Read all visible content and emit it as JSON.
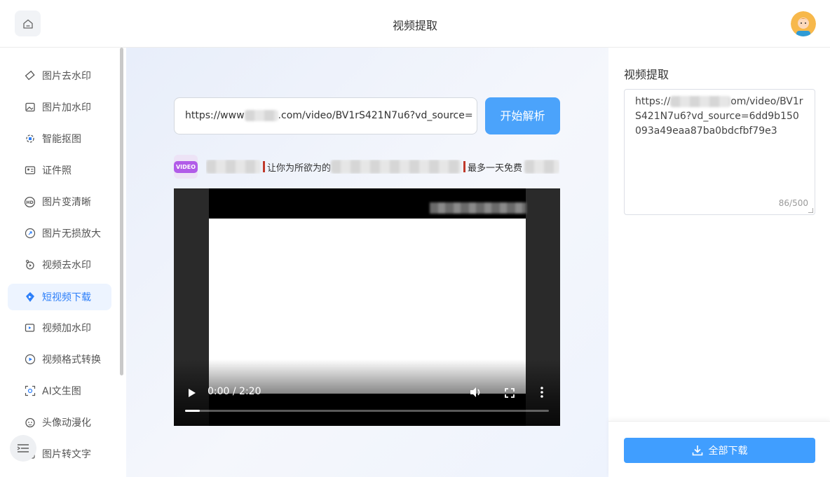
{
  "header": {
    "title": "视频提取"
  },
  "sidebar": {
    "items": [
      {
        "label": "图片去水印",
        "icon": "eraser-icon"
      },
      {
        "label": "图片加水印",
        "icon": "image-edit-icon"
      },
      {
        "label": "智能抠图",
        "icon": "cutout-icon"
      },
      {
        "label": "证件照",
        "icon": "id-card-icon"
      },
      {
        "label": "图片变清晰",
        "icon": "hd-icon"
      },
      {
        "label": "图片无损放大",
        "icon": "enlarge-icon"
      },
      {
        "label": "视频去水印",
        "icon": "video-clean-icon"
      },
      {
        "label": "短视频下载",
        "icon": "video-download-icon",
        "active": true
      },
      {
        "label": "视频加水印",
        "icon": "video-watermark-icon"
      },
      {
        "label": "视频格式转换",
        "icon": "video-convert-icon"
      },
      {
        "label": "AI文生图",
        "icon": "ai-image-icon"
      },
      {
        "label": "头像动漫化",
        "icon": "anime-avatar-icon"
      },
      {
        "label": "图片转文字",
        "icon": "ocr-icon"
      }
    ]
  },
  "main": {
    "url_value": "https://www██████.com/video/BV1rS421N7u6?vd_source=",
    "url_prefix": "https://www",
    "url_suffix": ".com/video/BV1rS421N7u6?vd_source=",
    "parse_button": "开始解析",
    "video_badge": "VIDEO",
    "title_part1": "让你为所欲为的",
    "title_part2": "最多一天免费",
    "player": {
      "time": "0:00 / 2:20",
      "progress": 0.04
    }
  },
  "right_panel": {
    "title": "视频提取",
    "text_prefix": "https://",
    "text_suffix": "om/video/BV1rS421N7u6?vd_source=6dd9b150093a49eaa87ba0bdcfbf79e3",
    "counter": "86/500",
    "download_button": "全部下载"
  },
  "colors": {
    "accent": "#409eff",
    "parse_button": "#4ba3fb",
    "active_bg": "#edf4ff",
    "active_text": "#2d7ff9"
  }
}
